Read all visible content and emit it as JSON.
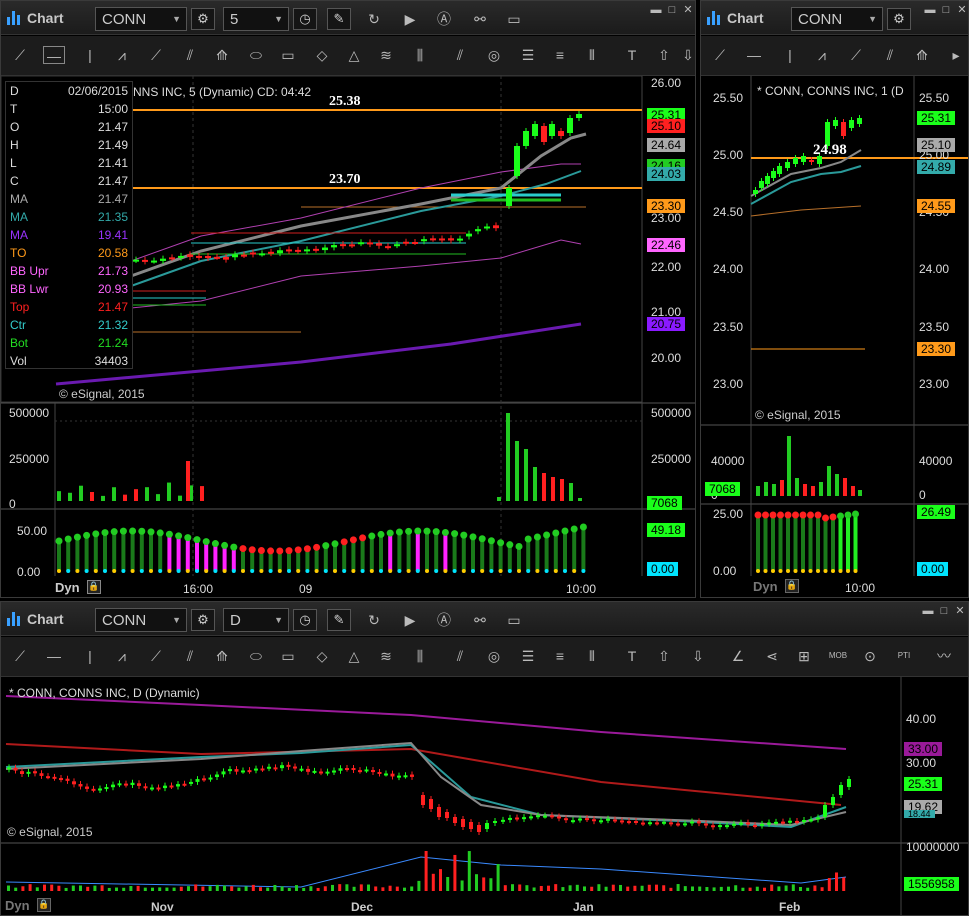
{
  "win1": {
    "title": "Chart",
    "symbol": "CONN",
    "interval": "5",
    "header": "NNS INC, 5 (Dynamic) CD: 04:42",
    "level_high": "25.38",
    "level_low": "23.70",
    "copyright": "© eSignal, 2015",
    "price_axis": [
      "26.00",
      "23.00",
      "22.00",
      "21.00",
      "20.00"
    ],
    "price_tags": [
      {
        "text": "25.31",
        "color": "#1aff1a"
      },
      {
        "text": "25.10",
        "color": "#ff2020"
      },
      {
        "text": "24.64",
        "color": "#aaaaaa"
      },
      {
        "text": "24.16",
        "color": "#22cc22"
      },
      {
        "text": "24.03",
        "color": "#33aaaa"
      },
      {
        "text": "23.30",
        "color": "#ff9a1a"
      },
      {
        "text": "22.46",
        "color": "#ff66ff"
      },
      {
        "text": "20.75",
        "color": "#8a1aff"
      }
    ],
    "vol_axis": [
      "500000",
      "250000",
      "0"
    ],
    "vol_tag": "7068",
    "osc_axis": [
      "50.00",
      "0.00"
    ],
    "osc_tags": [
      "49.18",
      "0.00"
    ],
    "time_axis": [
      "16:00",
      "09",
      "10:00"
    ],
    "dyn": "Dyn",
    "info": [
      {
        "k": "D",
        "v": "02/06/2015",
        "c": "#dddddd"
      },
      {
        "k": "T",
        "v": "15:00",
        "c": "#dddddd"
      },
      {
        "k": "O",
        "v": "21.47",
        "c": "#dddddd"
      },
      {
        "k": "H",
        "v": "21.49",
        "c": "#dddddd"
      },
      {
        "k": "L",
        "v": "21.41",
        "c": "#dddddd"
      },
      {
        "k": "C",
        "v": "21.47",
        "c": "#dddddd"
      },
      {
        "k": "MA",
        "v": "21.47",
        "c": "#aaaaaa"
      },
      {
        "k": "MA",
        "v": "21.35",
        "c": "#33aaaa"
      },
      {
        "k": "MA",
        "v": "19.41",
        "c": "#9a33ff"
      },
      {
        "k": "TO",
        "v": "20.58",
        "c": "#ff9a1a"
      },
      {
        "k": "BB Upr",
        "v": "21.73",
        "c": "#ff66ff"
      },
      {
        "k": "BB Lwr",
        "v": "20.93",
        "c": "#ff66ff"
      },
      {
        "k": "Top",
        "v": "21.47",
        "c": "#ff2020"
      },
      {
        "k": "Ctr",
        "v": "21.32",
        "c": "#33cccc"
      },
      {
        "k": "Bot",
        "v": "21.24",
        "c": "#22dd22"
      },
      {
        "k": "Vol",
        "v": "34403",
        "c": "#dddddd"
      }
    ]
  },
  "win2": {
    "title": "Chart",
    "symbol": "CONN",
    "header": "* CONN, CONNS INC, 1 (D",
    "level": "24.98",
    "copyright": "© eSignal, 2015",
    "price_axis": [
      "25.50",
      "25.00",
      "24.50",
      "24.00",
      "23.50",
      "23.00"
    ],
    "price_tags": [
      {
        "text": "25.31",
        "color": "#1aff1a"
      },
      {
        "text": "25.10",
        "color": "#aaaaaa"
      },
      {
        "text": "24.89",
        "color": "#33aaaa"
      },
      {
        "text": "24.55",
        "color": "#ff9a1a"
      },
      {
        "text": "23.30",
        "color": "#ff9a1a"
      }
    ],
    "vol_axis": [
      "40000",
      "0"
    ],
    "vol_tag": "7068",
    "osc_axis": [
      "25.00",
      "0.00"
    ],
    "osc_tags": [
      "26.49",
      "0.00"
    ],
    "time_axis": [
      "10:00"
    ],
    "dyn": "Dyn"
  },
  "win3": {
    "title": "Chart",
    "symbol": "CONN",
    "interval": "D",
    "header": "* CONN, CONNS INC, D (Dynamic)",
    "copyright": "© eSignal, 2015",
    "price_axis": [
      "40.00",
      "30.00"
    ],
    "price_tags": [
      {
        "text": "33.00",
        "color": "#9a1a9a"
      },
      {
        "text": "25.31",
        "color": "#1aff1a"
      },
      {
        "text": "19.62",
        "color": "#aaaaaa"
      },
      {
        "text": "18.44",
        "color": "#33aaaa"
      }
    ],
    "vol_axis": [
      "10000000"
    ],
    "vol_tag": "1556958",
    "time_axis": [
      "Nov",
      "Dec",
      "Jan",
      "Feb"
    ],
    "dyn": "Dyn"
  }
}
